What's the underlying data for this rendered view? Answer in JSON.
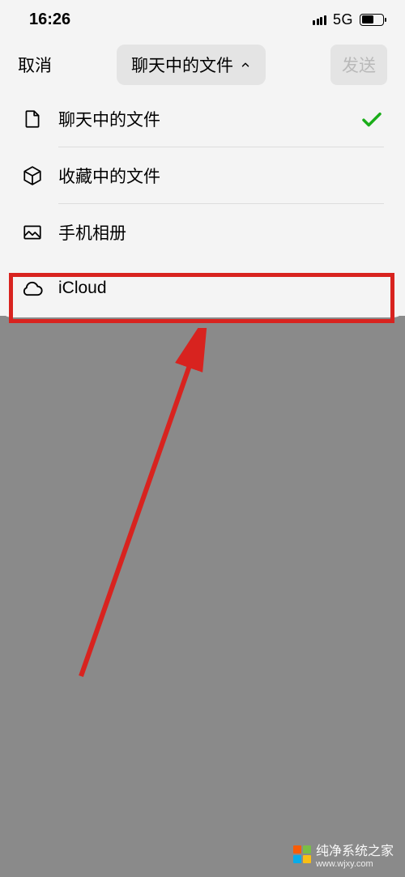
{
  "status": {
    "time": "16:26",
    "network": "5G"
  },
  "header": {
    "cancel": "取消",
    "title": "聊天中的文件",
    "send": "发送"
  },
  "menu": {
    "items": [
      {
        "label": "聊天中的文件",
        "icon": "file-icon",
        "selected": true
      },
      {
        "label": "收藏中的文件",
        "icon": "cube-icon",
        "selected": false
      },
      {
        "label": "手机相册",
        "icon": "image-icon",
        "selected": false
      },
      {
        "label": "iCloud",
        "icon": "cloud-icon",
        "selected": false
      }
    ]
  },
  "annotation": {
    "highlight_color": "#d8231f"
  },
  "watermark": {
    "text": "纯净系统之家",
    "url": "www.wjxy.com"
  }
}
